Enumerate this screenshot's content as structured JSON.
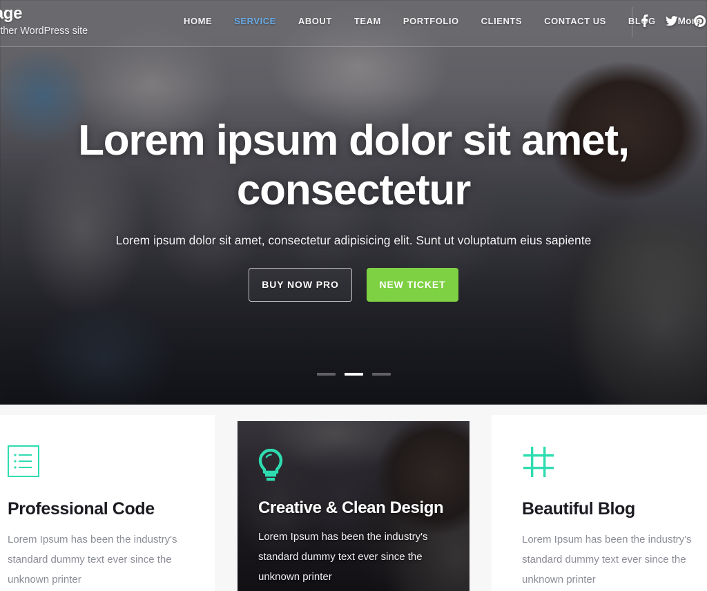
{
  "brand": {
    "title": "Page",
    "tagline": "another WordPress site"
  },
  "nav": {
    "items": [
      {
        "label": "HOME",
        "active": false
      },
      {
        "label": "SERVICE",
        "active": true
      },
      {
        "label": "ABOUT",
        "active": false
      },
      {
        "label": "TEAM",
        "active": false
      },
      {
        "label": "PORTFOLIO",
        "active": false
      },
      {
        "label": "CLIENTS",
        "active": false
      },
      {
        "label": "CONTACT US",
        "active": false
      },
      {
        "label": "BLOG",
        "active": false
      }
    ],
    "more_label": "More"
  },
  "social": {
    "items": [
      {
        "name": "facebook-icon"
      },
      {
        "name": "twitter-icon"
      },
      {
        "name": "pinterest-icon"
      }
    ]
  },
  "hero": {
    "title_line1": "Lorem ipsum dolor sit amet,",
    "title_line2": "consectetur",
    "subtitle": "Lorem ipsum dolor sit amet, consectetur adipisicing elit. Sunt ut voluptatum eius sapiente",
    "primary_button": "BUY NOW PRO",
    "secondary_button": "NEW TICKET",
    "slides": [
      {
        "active": false
      },
      {
        "active": true
      },
      {
        "active": false
      }
    ]
  },
  "features": {
    "cards": [
      {
        "icon": "list-icon",
        "title": "Professional Code",
        "text": "Lorem Ipsum has been the industry's standard dummy text ever since the unknown printer"
      },
      {
        "icon": "lightbulb-icon",
        "title": "Creative & Clean Design",
        "text": "Lorem Ipsum has been the industry's standard dummy text ever since the unknown printer"
      },
      {
        "icon": "hash-icon",
        "title": "Beautiful Blog",
        "text": "Lorem Ipsum has been the industry's standard dummy text ever since the unknown printer"
      }
    ]
  },
  "colors": {
    "accent_teal": "#2edcb0",
    "accent_green": "#7ed143",
    "active_nav_blue": "#6aace9",
    "section_bg": "#f7f7f7",
    "card_bg": "#ffffff",
    "dark_card_bg": "#232024",
    "title_dark": "#1d1b22",
    "body_gray": "#8b8d96"
  }
}
